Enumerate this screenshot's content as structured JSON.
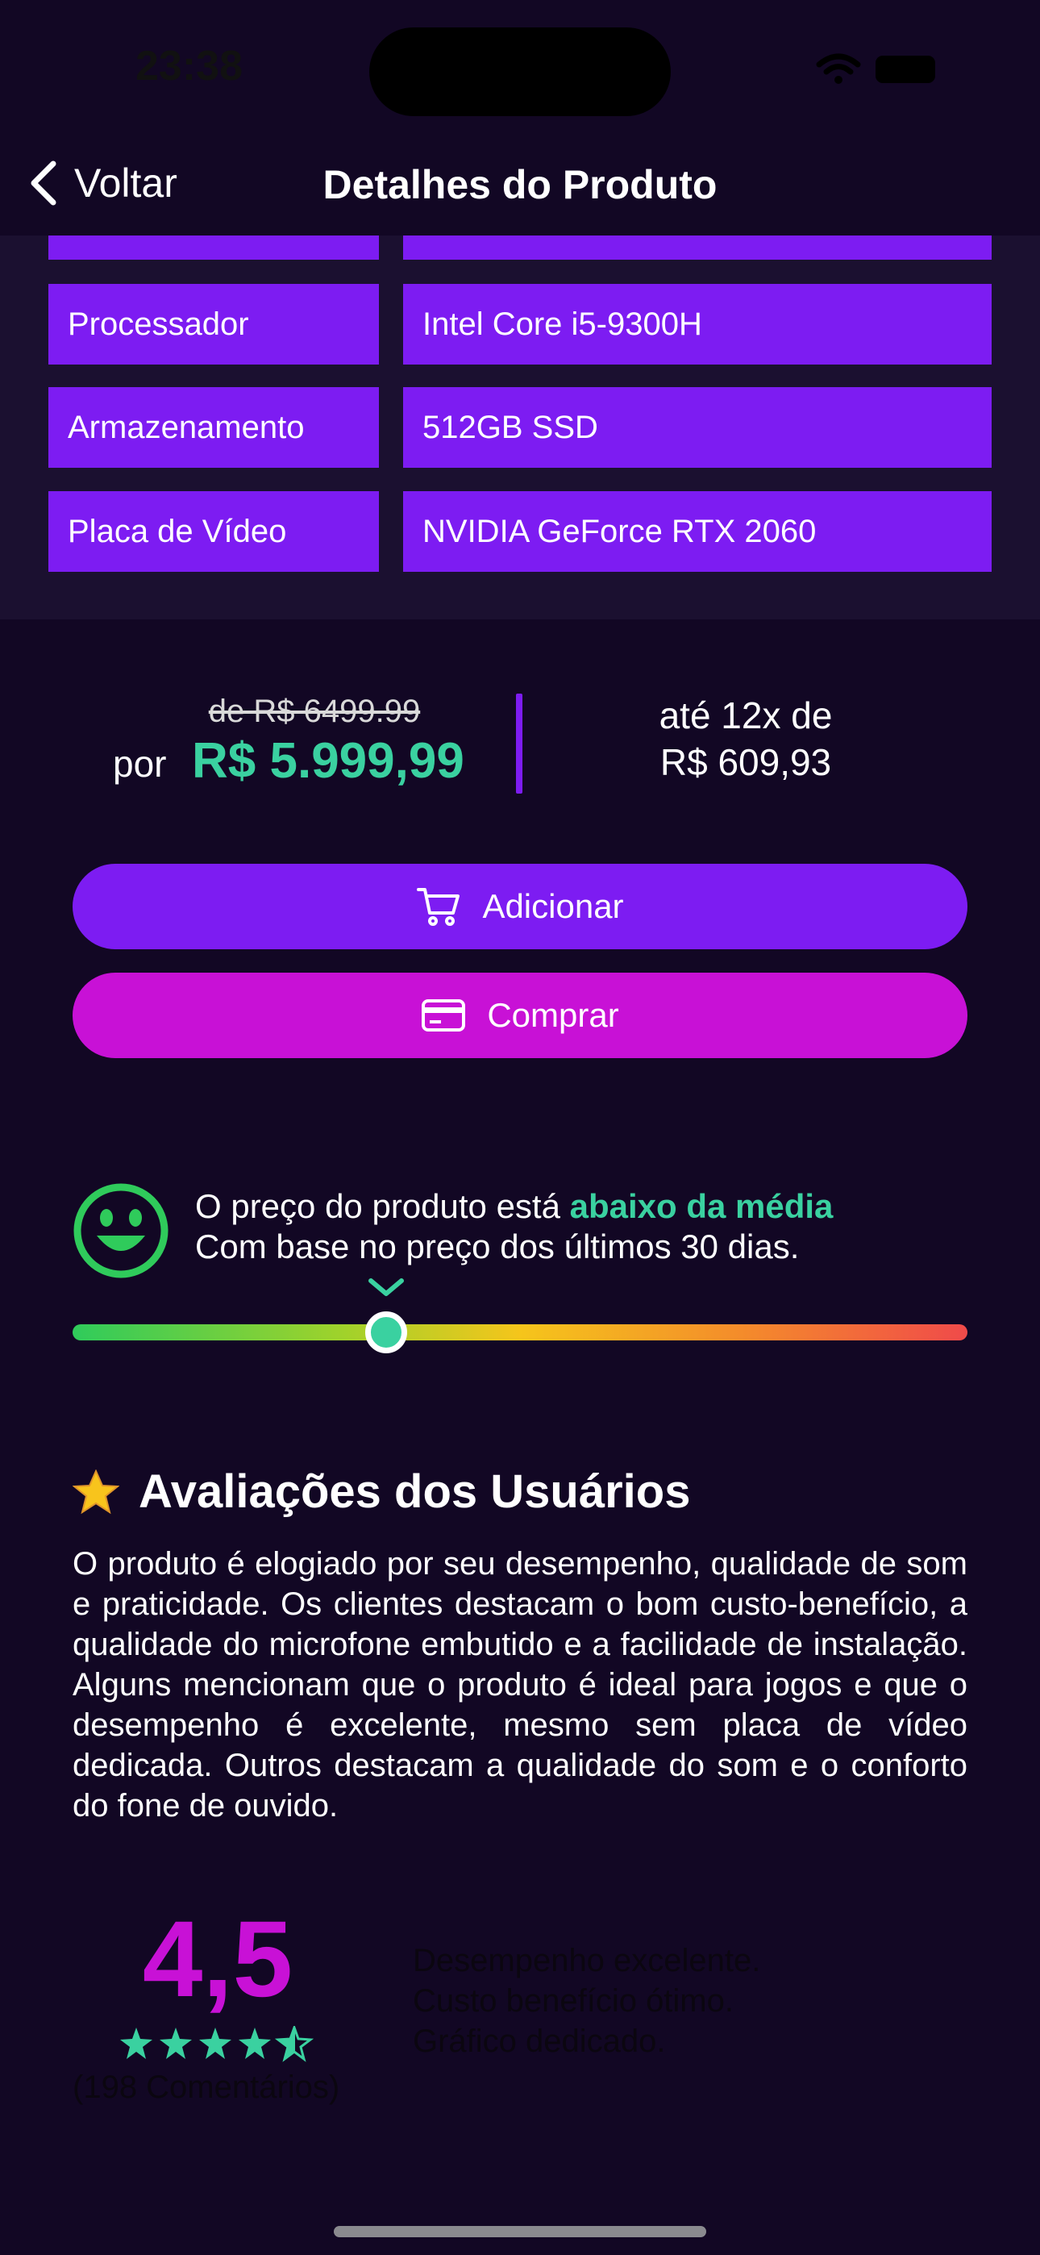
{
  "status_bar": {
    "time": "23:38"
  },
  "nav": {
    "back_label": "Voltar",
    "title": "Detalhes do Produto"
  },
  "specs": [
    {
      "label": "",
      "value": ""
    },
    {
      "label": "Processador",
      "value": "Intel Core i5-9300H"
    },
    {
      "label": "Armazenamento",
      "value": "512GB SSD"
    },
    {
      "label": "Placa de Vídeo",
      "value": "NVIDIA GeForce RTX 2060"
    }
  ],
  "price": {
    "old": "de R$ 6499.99",
    "por_label": "por",
    "current": "R$ 5.999,99",
    "installments_line1": "até 12x de",
    "installments_line2": "R$ 609,93"
  },
  "actions": {
    "add_label": "Adicionar",
    "buy_label": "Comprar"
  },
  "price_insight": {
    "line1_prefix": "O preço do produto está ",
    "line1_highlight": "abaixo da média",
    "line2": "Com base no preço dos últimos 30 dias.",
    "position_fraction": 0.35
  },
  "reviews": {
    "title": "Avaliações dos Usuários",
    "summary": "O produto é elogiado por seu desempenho, qualidade de som e praticidade. Os clientes destacam o bom custo-benefício, a qualidade do microfone embutido e a facilidade de instalação. Alguns mencionam que o produto é ideal para jogos e que o desempenho é excelente, mesmo sem placa de vídeo dedicada. Outros destacam a qualidade do som e o conforto do fone de ouvido.",
    "rating": "4,5",
    "rating_value": 4.5,
    "rating_max": 5,
    "count": "(198 Comentários)",
    "highlights": [
      "Desempenho excelente.",
      "Custo benefício ótimo.",
      "Gráfico dedicado."
    ]
  },
  "colors": {
    "background": "#120724",
    "panel": "#1b1030",
    "purple": "#7d1cf2",
    "magenta": "#c811d6",
    "teal": "#3ad1a0",
    "smiley_green": "#2fcb5b"
  },
  "icons": [
    "chevron-left-icon",
    "cart-icon",
    "credit-card-icon",
    "smiley-icon",
    "chevron-down-icon",
    "star-emoji-icon",
    "star-icon"
  ]
}
